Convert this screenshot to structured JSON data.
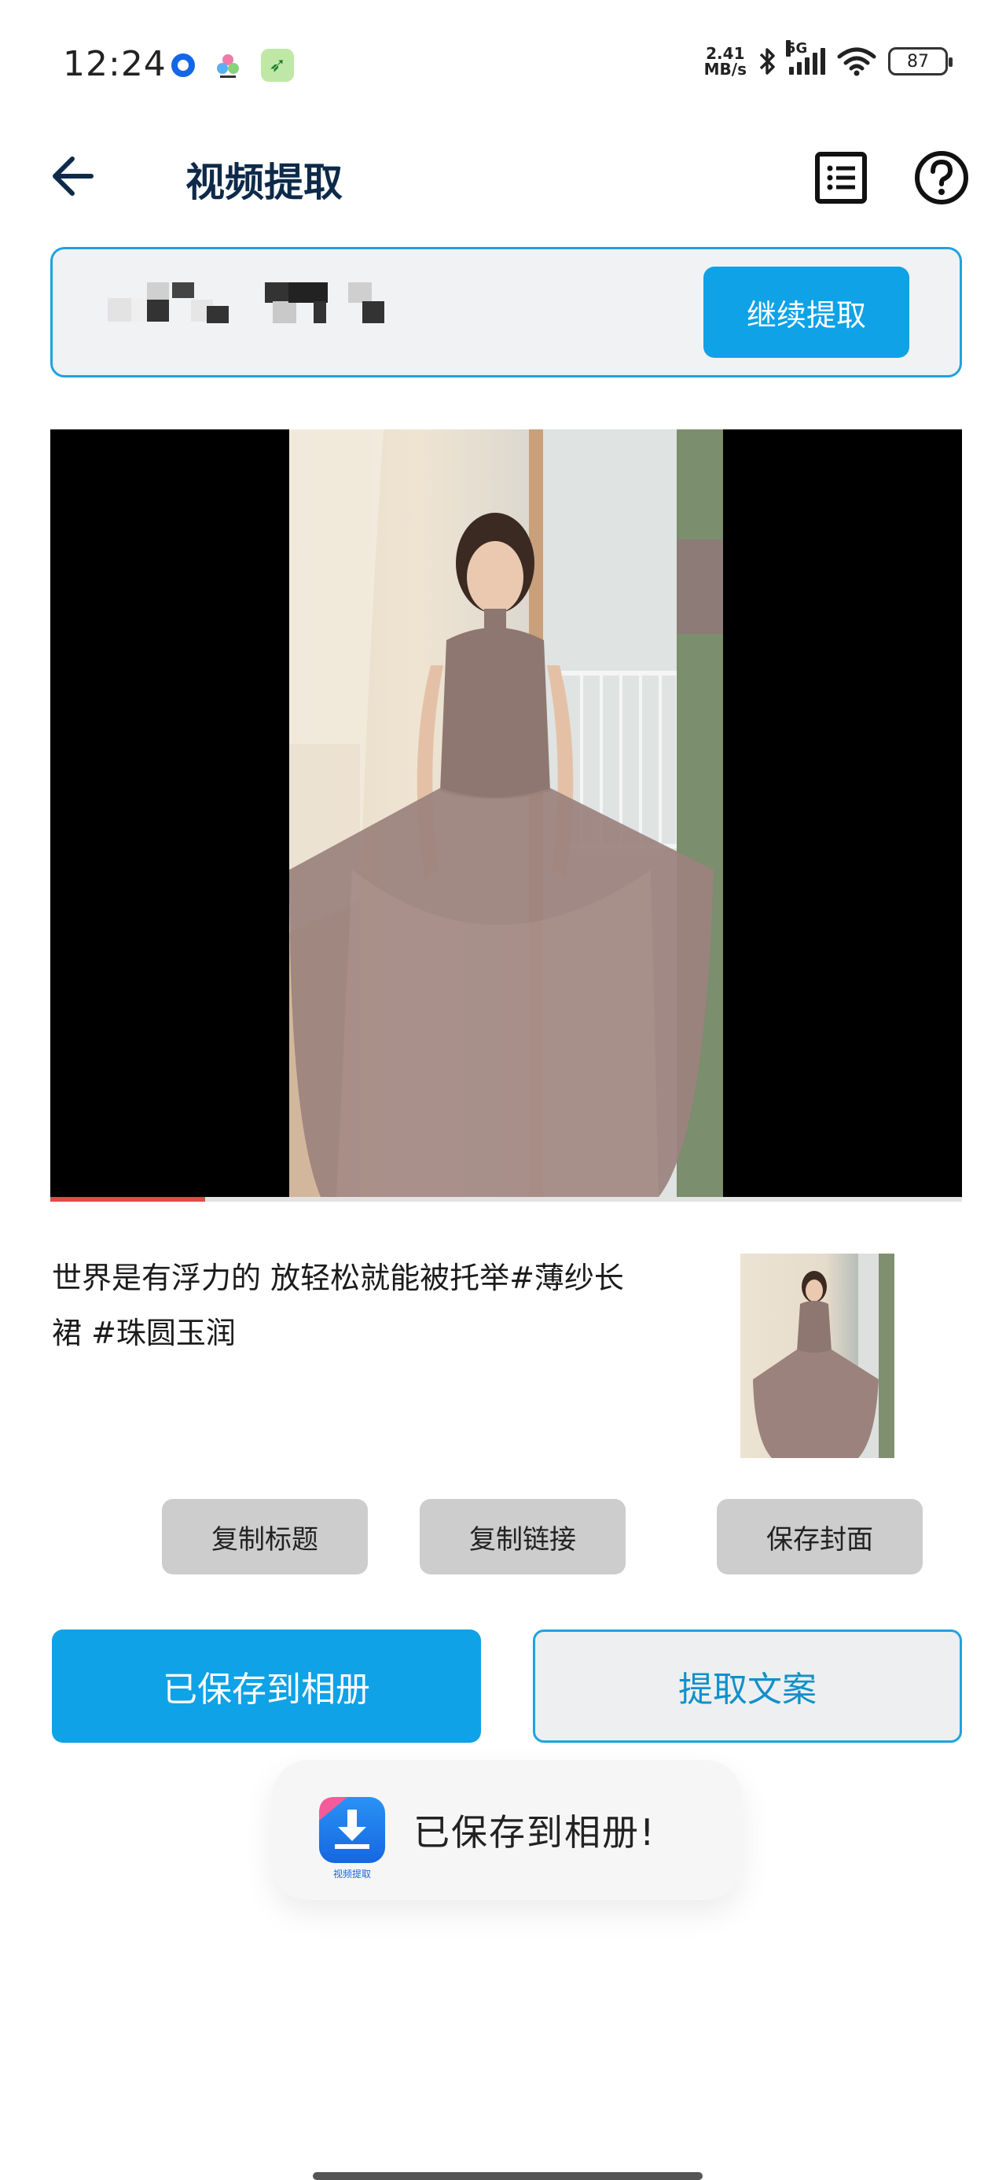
{
  "status_bar": {
    "time": "12:24",
    "net_speed_value": "2.41",
    "net_speed_unit": "MB/s",
    "network_label": "5G",
    "battery": "87"
  },
  "header": {
    "title": "视频提取"
  },
  "url_bar": {
    "continue_label": "继续提取"
  },
  "video": {
    "progress_fraction": 0.17
  },
  "description": {
    "text": "世界是有浮力的 放轻松就能被托举#薄纱长裙 #珠圆玉润"
  },
  "actions": {
    "copy_title": "复制标题",
    "copy_link": "复制链接",
    "save_cover": "保存封面",
    "saved_to_album": "已保存到相册",
    "extract_copy": "提取文案"
  },
  "toast": {
    "app_name": "视频提取",
    "message": "已保存到相册!"
  },
  "colors": {
    "accent": "#0fa2e6",
    "title": "#0e2a4a",
    "progress": "#e34a4a"
  }
}
